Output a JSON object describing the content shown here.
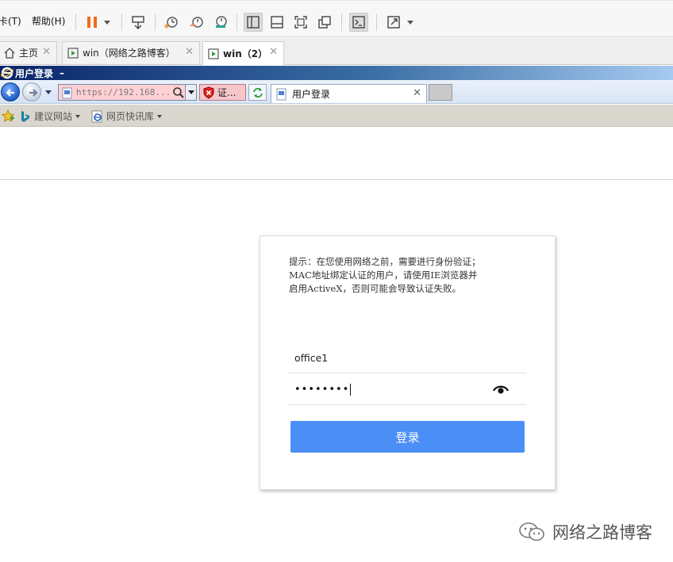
{
  "vm_menu": {
    "tab_menu": "卡(T)",
    "help_menu": "帮助(H)"
  },
  "vm_tabs": [
    {
      "label": "主页",
      "icon": "home-icon"
    },
    {
      "label": "win（网络之路博客）",
      "icon": "vm-running-icon"
    },
    {
      "label": "win（2）",
      "icon": "vm-running-icon",
      "active": true
    }
  ],
  "ie": {
    "window_title": "用户登录",
    "address": "https://192.168....",
    "cert_label": "证...",
    "tab_title": "用户登录",
    "favorites": [
      {
        "label": "建议网站",
        "icon": "bing-icon"
      },
      {
        "label": "网页快讯库",
        "icon": "ie-feed-icon"
      }
    ]
  },
  "login": {
    "tip": "提示：在您使用网络之前，需要进行身份验证；MAC地址绑定认证的用户，请使用IE浏览器并启用ActiveX，否则可能会导致认证失败。",
    "tip_lines": [
      "提示：在您使用网络之前，需要进行身份验证；",
      "MAC地址绑定认证的用户，请使用IE浏览器并",
      "启用ActiveX，否则可能会导致认证失败。"
    ],
    "username": "office1",
    "password_mask": "••••••••",
    "submit_label": "登录"
  },
  "watermark": {
    "text": "网络之路博客"
  },
  "colors": {
    "login_button": "#4b8ef5",
    "pause_icon": "#ef6c1a",
    "address_insecure_bg": "#ffd0d4",
    "ie_title_bar": "#0a246a"
  }
}
